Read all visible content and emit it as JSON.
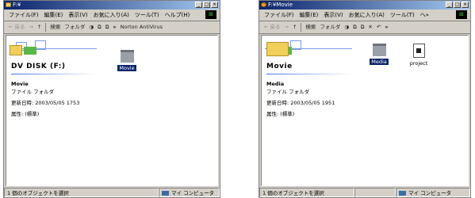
{
  "left_window": {
    "title": "F:¥",
    "title_buttons": [
      "_",
      "□",
      "×"
    ],
    "menu": [
      "ファイル(F)",
      "編集(E)",
      "表示(V)",
      "お気に入り(A)",
      "ツール(T)",
      "ヘルプ(H)"
    ],
    "toolbar": {
      "back": "← 戻る",
      "forward": "→",
      "up": "↑",
      "search": "検索",
      "folders": "フォルダ",
      "more": "»",
      "norton": "Norton AntiVirus"
    },
    "pane_title": "DV DISK (F:)",
    "info": {
      "name": "Movie",
      "type": "ファイル フォルダ",
      "modified": "更新日時: 2003/05/05 1753",
      "attributes": "属性: (標準)"
    },
    "items": [
      {
        "label": "Movie",
        "selected": true
      }
    ],
    "status": {
      "left": "1 個のオブジェクトを選択",
      "right": "マイ コンピュータ"
    }
  },
  "right_window": {
    "title": "F:¥Movie",
    "title_buttons": [
      "_",
      "□",
      "×"
    ],
    "menu": [
      "ファイル(F)",
      "編集(E)",
      "表示(V)",
      "お気に入り(A)",
      "ツール(T)",
      "ヘ»"
    ],
    "toolbar": {
      "back": "← 戻る",
      "forward": "→",
      "up": "↑",
      "search": "検索",
      "folders": "フォルダ",
      "more": "»"
    },
    "pane_title": "Movie",
    "info": {
      "name": "Media",
      "type": "ファイル フォルダ",
      "modified": "更新日時: 2003/05/05 1951",
      "attributes": "属性: (標準)"
    },
    "items": [
      {
        "label": "Media",
        "selected": true
      },
      {
        "label": "project",
        "selected": false
      }
    ],
    "status": {
      "left": "1 個のオブジェクトを選択",
      "right": "マイ コンピュータ"
    }
  }
}
